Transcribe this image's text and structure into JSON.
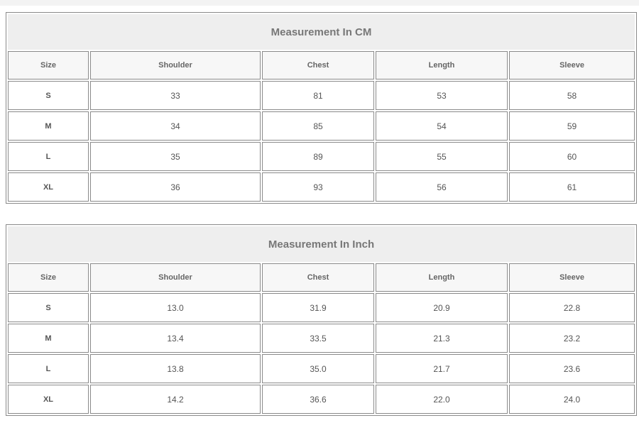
{
  "tables": [
    {
      "title": "Measurement In CM",
      "headers": [
        "Size",
        "Shoulder",
        "Chest",
        "Length",
        "Sleeve"
      ],
      "rows": [
        [
          "S",
          "33",
          "81",
          "53",
          "58"
        ],
        [
          "M",
          "34",
          "85",
          "54",
          "59"
        ],
        [
          "L",
          "35",
          "89",
          "55",
          "60"
        ],
        [
          "XL",
          "36",
          "93",
          "56",
          "61"
        ]
      ]
    },
    {
      "title": "Measurement In Inch",
      "headers": [
        "Size",
        "Shoulder",
        "Chest",
        "Length",
        "Sleeve"
      ],
      "rows": [
        [
          "S",
          "13.0",
          "31.9",
          "20.9",
          "22.8"
        ],
        [
          "M",
          "13.4",
          "33.5",
          "21.3",
          "23.2"
        ],
        [
          "L",
          "13.8",
          "35.0",
          "21.7",
          "23.6"
        ],
        [
          "XL",
          "14.2",
          "36.6",
          "22.0",
          "24.0"
        ]
      ]
    }
  ]
}
